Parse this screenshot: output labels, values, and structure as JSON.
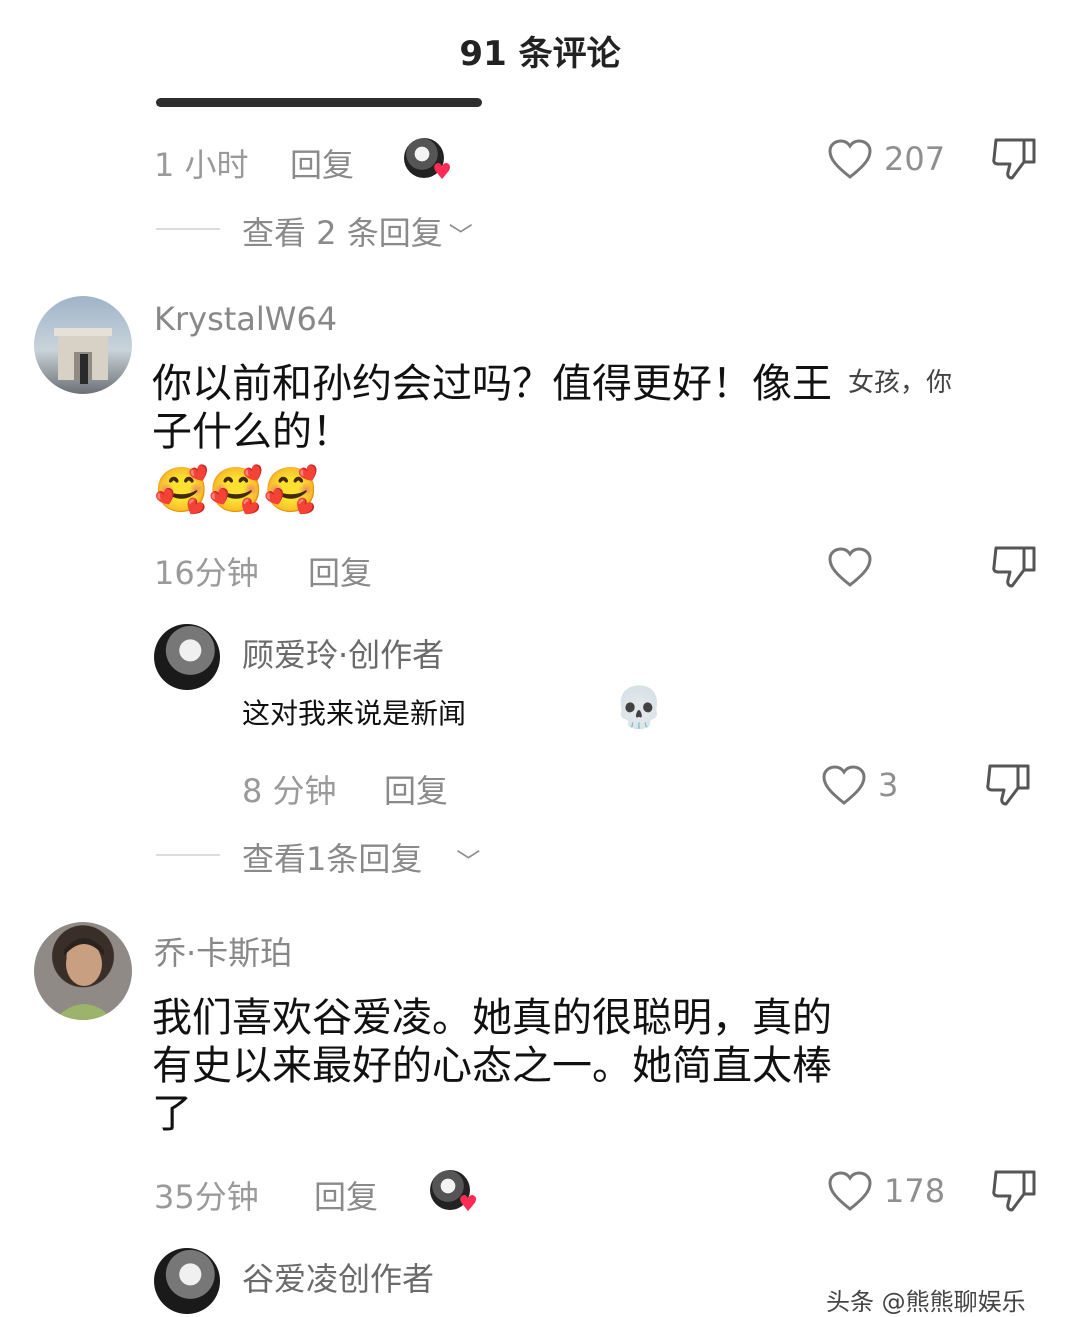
{
  "header": {
    "title": "91 条评论"
  },
  "comments": [
    {
      "time": "1 小时",
      "reply_label": "回复",
      "likes": "207",
      "view_replies": "查看 2 条回复"
    },
    {
      "username": "KrystalW64",
      "text_line1": "你以前和孙约会过吗？值得更好！像王",
      "text_line2": "子什么的！",
      "overlay_text": "女孩，你",
      "emojis": "🥰🥰🥰",
      "time": "16分钟",
      "reply_label": "回复",
      "creator_reply": {
        "name": "顾爱玲·创作者",
        "text": "这对我来说是新闻",
        "emoji": "💀",
        "time": "8 分钟",
        "reply_label": "回复",
        "likes": "3"
      },
      "view_replies": "查看1条回复"
    },
    {
      "username": "乔·卡斯珀",
      "text_line1": "我们喜欢谷爱凌。她真的很聪明，真的",
      "text_line2": "有史以来最好的心态之一。她简直太棒",
      "text_line3": "了",
      "time": "35分钟",
      "reply_label": "回复",
      "likes": "178",
      "creator_reply": {
        "name": "谷爱凌创作者"
      }
    }
  ],
  "watermark": "头条 @熊熊聊娱乐"
}
